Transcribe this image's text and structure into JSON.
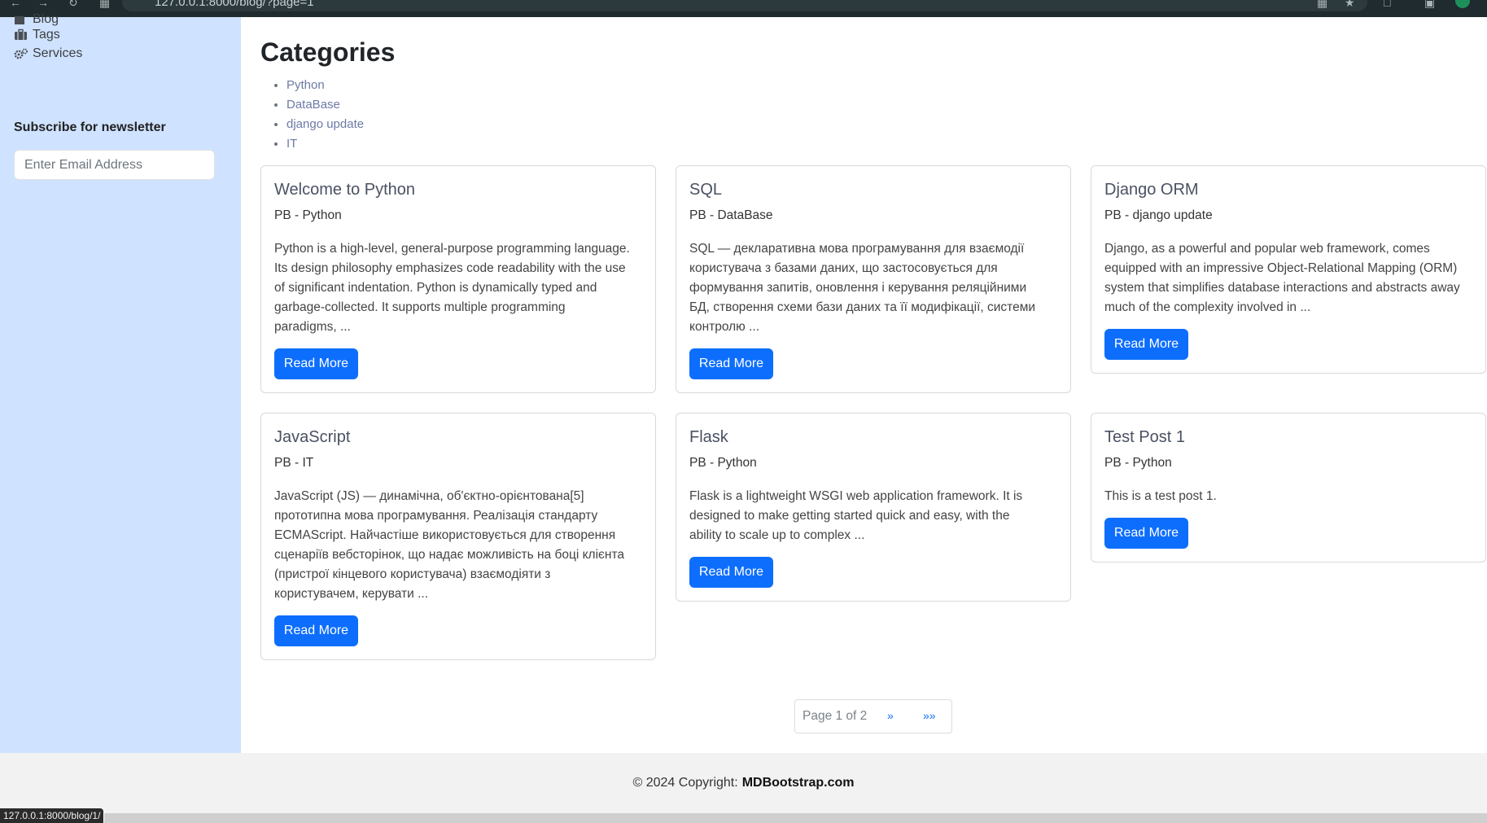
{
  "browser": {
    "url": "127.0.0.1:8000/blog/?page=1"
  },
  "sidebar": {
    "items": [
      {
        "label": "Blog",
        "icon": "blog-icon"
      },
      {
        "label": "Tags",
        "icon": "briefcase-icon"
      },
      {
        "label": "Services",
        "icon": "gears-icon"
      }
    ],
    "newsletter_title": "Subscribe for newsletter",
    "email_placeholder": "Enter Email Address"
  },
  "main": {
    "categories_title": "Categories",
    "categories": [
      "Python",
      "DataBase",
      "django update",
      "IT"
    ]
  },
  "posts": [
    {
      "title": "Welcome to Python",
      "meta": "PB - Python",
      "lines": [
        "Python is a high-level, general-purpose programming language.",
        "Its design philosophy emphasizes code readability with the use",
        "of significant indentation. Python is dynamically typed and",
        "garbage-collected. It supports multiple programming",
        "paradigms, ..."
      ],
      "button": "Read More"
    },
    {
      "title": "SQL",
      "meta": "PB - DataBase",
      "lines": [
        "SQL — декларативна мова програмування для взаємодії",
        "користувача з базами даних, що застосовується для",
        "формування запитів, оновлення і керування реляційними",
        "БД, створення схеми бази даних та її модифікації, системи",
        "контролю ..."
      ],
      "button": "Read More"
    },
    {
      "title": "Django ORM",
      "meta": "PB - django update",
      "lines": [
        "Django, as a powerful and popular web framework, comes",
        "equipped with an impressive Object-Relational Mapping (ORM)",
        "system that simplifies database interactions and abstracts away",
        "much of the complexity involved in ..."
      ],
      "button": "Read More"
    },
    {
      "title": "JavaScript",
      "meta": "PB - IT",
      "lines": [
        "JavaScript (JS) — динамічна, об'єктно-орієнтована[5]",
        "прототипна мова програмування. Реалізація стандарту",
        "ECMAScript. Найчастіше використовується для створення",
        "сценаріїв вебсторінок, що надає можливість на боці клієнта",
        "(пристрої кінцевого користувача) взаємодіяти з",
        "користувачем, керувати ..."
      ],
      "button": "Read More"
    },
    {
      "title": "Flask",
      "meta": "PB - Python",
      "lines": [
        "Flask is a lightweight WSGI web application framework. It is",
        "designed to make getting started quick and easy, with the",
        "ability to scale up to complex ..."
      ],
      "button": "Read More"
    },
    {
      "title": "Test Post 1",
      "meta": "PB - Python",
      "lines": [
        "This is a test post 1."
      ],
      "button": "Read More"
    }
  ],
  "pagination": {
    "info": "Page 1 of 2",
    "next": "»",
    "last": "»»"
  },
  "footer": {
    "text": "© 2024 Copyright:",
    "brand": "MDBootstrap.com"
  },
  "status_tooltip": "127.0.0.1:8000/blog/1/",
  "colors": {
    "sidebar_bg": "#cfe2ff",
    "primary": "#0d6efd",
    "footer_bg": "#f2f2f2"
  }
}
